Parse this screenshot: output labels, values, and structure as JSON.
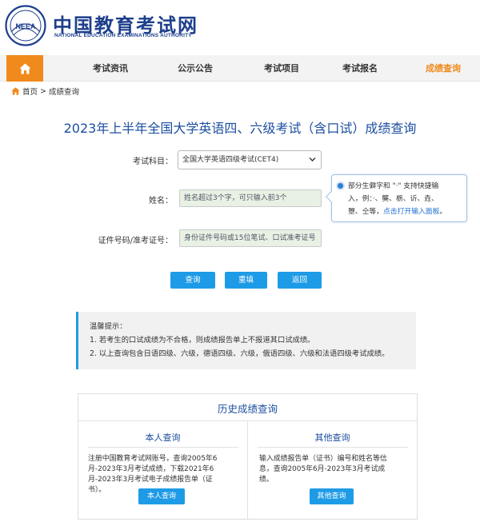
{
  "header": {
    "title": "中国教育考试网",
    "subtitle": "NATIONAL EDUCATION EXAMINATIONS AUTHORITY",
    "seal_text": "NEEA"
  },
  "nav": {
    "items": [
      "考试资讯",
      "公示公告",
      "考试项目",
      "考试报名",
      "成绩查询"
    ],
    "active_index": 4,
    "home_icon": "home-icon",
    "accent_color": "#f08a1c"
  },
  "breadcrumb": {
    "home": "首页",
    "separator": ">",
    "current": "成绩查询"
  },
  "page_title": "2023年上半年全国大学英语四、六级考试（含口试）成绩查询",
  "form": {
    "subject_label": "考试科目：",
    "subject_value": "全国大学英语四级考试(CET4)",
    "name_label": "姓名：",
    "name_placeholder": "姓名超过3个字，可只输入前3个",
    "id_label": "证件号码/准考证号：",
    "id_placeholder": "身份证件号码或15位笔试、口试准考证号"
  },
  "tip": {
    "line1": "部分生僻字和 \"·\" 支持快捷输",
    "line2": "入，例：·、龑、栃、䜣、垚、",
    "line3_prefix": "曌、仝等，",
    "link": "点击打开输入面板",
    "line3_suffix": "。"
  },
  "buttons": {
    "query": "查询",
    "reset": "重填",
    "back": "返回",
    "color": "#1e9be6"
  },
  "notice": {
    "title": "温馨提示：",
    "items": [
      "1. 若考生的口试成绩为不合格，则成绩报告单上不报道其口试成绩。",
      "2. 以上查询包含日语四级、六级，德语四级、六级，俄语四级、六级和法语四级考试成绩。"
    ]
  },
  "history": {
    "title": "历史成绩查询",
    "self": {
      "title": "本人查询",
      "desc_lines": [
        "注册中国教育考试网账号，查询2005年6",
        "月-2023年3月考试成绩，下载2021年6",
        "月-2023年3月考试电子成绩报告单（证",
        "书）。"
      ],
      "button": "本人查询"
    },
    "other": {
      "title": "其他查询",
      "desc_lines": [
        "输入成绩报告单（证书）编号和姓名等信",
        "息，查询2005年6月-2023年3月考试成",
        "绩。"
      ],
      "button": "其他查询"
    }
  }
}
